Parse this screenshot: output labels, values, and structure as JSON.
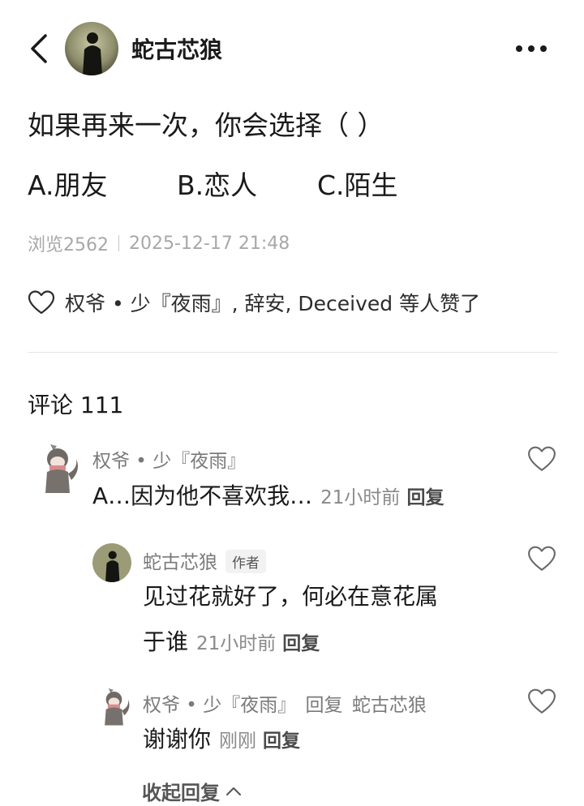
{
  "header": {
    "back_icon": "chevron-left-icon",
    "author_name": "蛇古芯狼",
    "more_icon": "more-horizontal-icon"
  },
  "post": {
    "question": "如果再来一次，你会选择（      ）",
    "options": [
      "A.朋友",
      "B.恋人",
      "C.陌生"
    ],
    "views": "浏览2562",
    "datetime": "2025-12-17 21:48",
    "likes_text": "权爷 • 少『夜雨』, 辞安, Deceived 等人赞了"
  },
  "comments_header": "评论 111",
  "comments": [
    {
      "name": "权爷 • 少『夜雨』",
      "text": "A…因为他不喜欢我…",
      "time": "21小时前",
      "reply_label": "回复"
    },
    {
      "name": "蛇古芯狼",
      "badge": "作者",
      "text_line1": "见过花就好了，何必在意花属",
      "text_line2": "于谁",
      "time": "21小时前",
      "reply_label": "回复"
    },
    {
      "name": "权爷 • 少『夜雨』",
      "reply_word": "回复",
      "reply_target": "蛇古芯狼",
      "text": "谢谢你",
      "time": "刚刚",
      "reply_label": "回复"
    }
  ],
  "collapse_label": "收起回复",
  "colors": {
    "text": "#1a1a1a",
    "meta": "#a8a8a8",
    "name": "#7a7a7a"
  }
}
